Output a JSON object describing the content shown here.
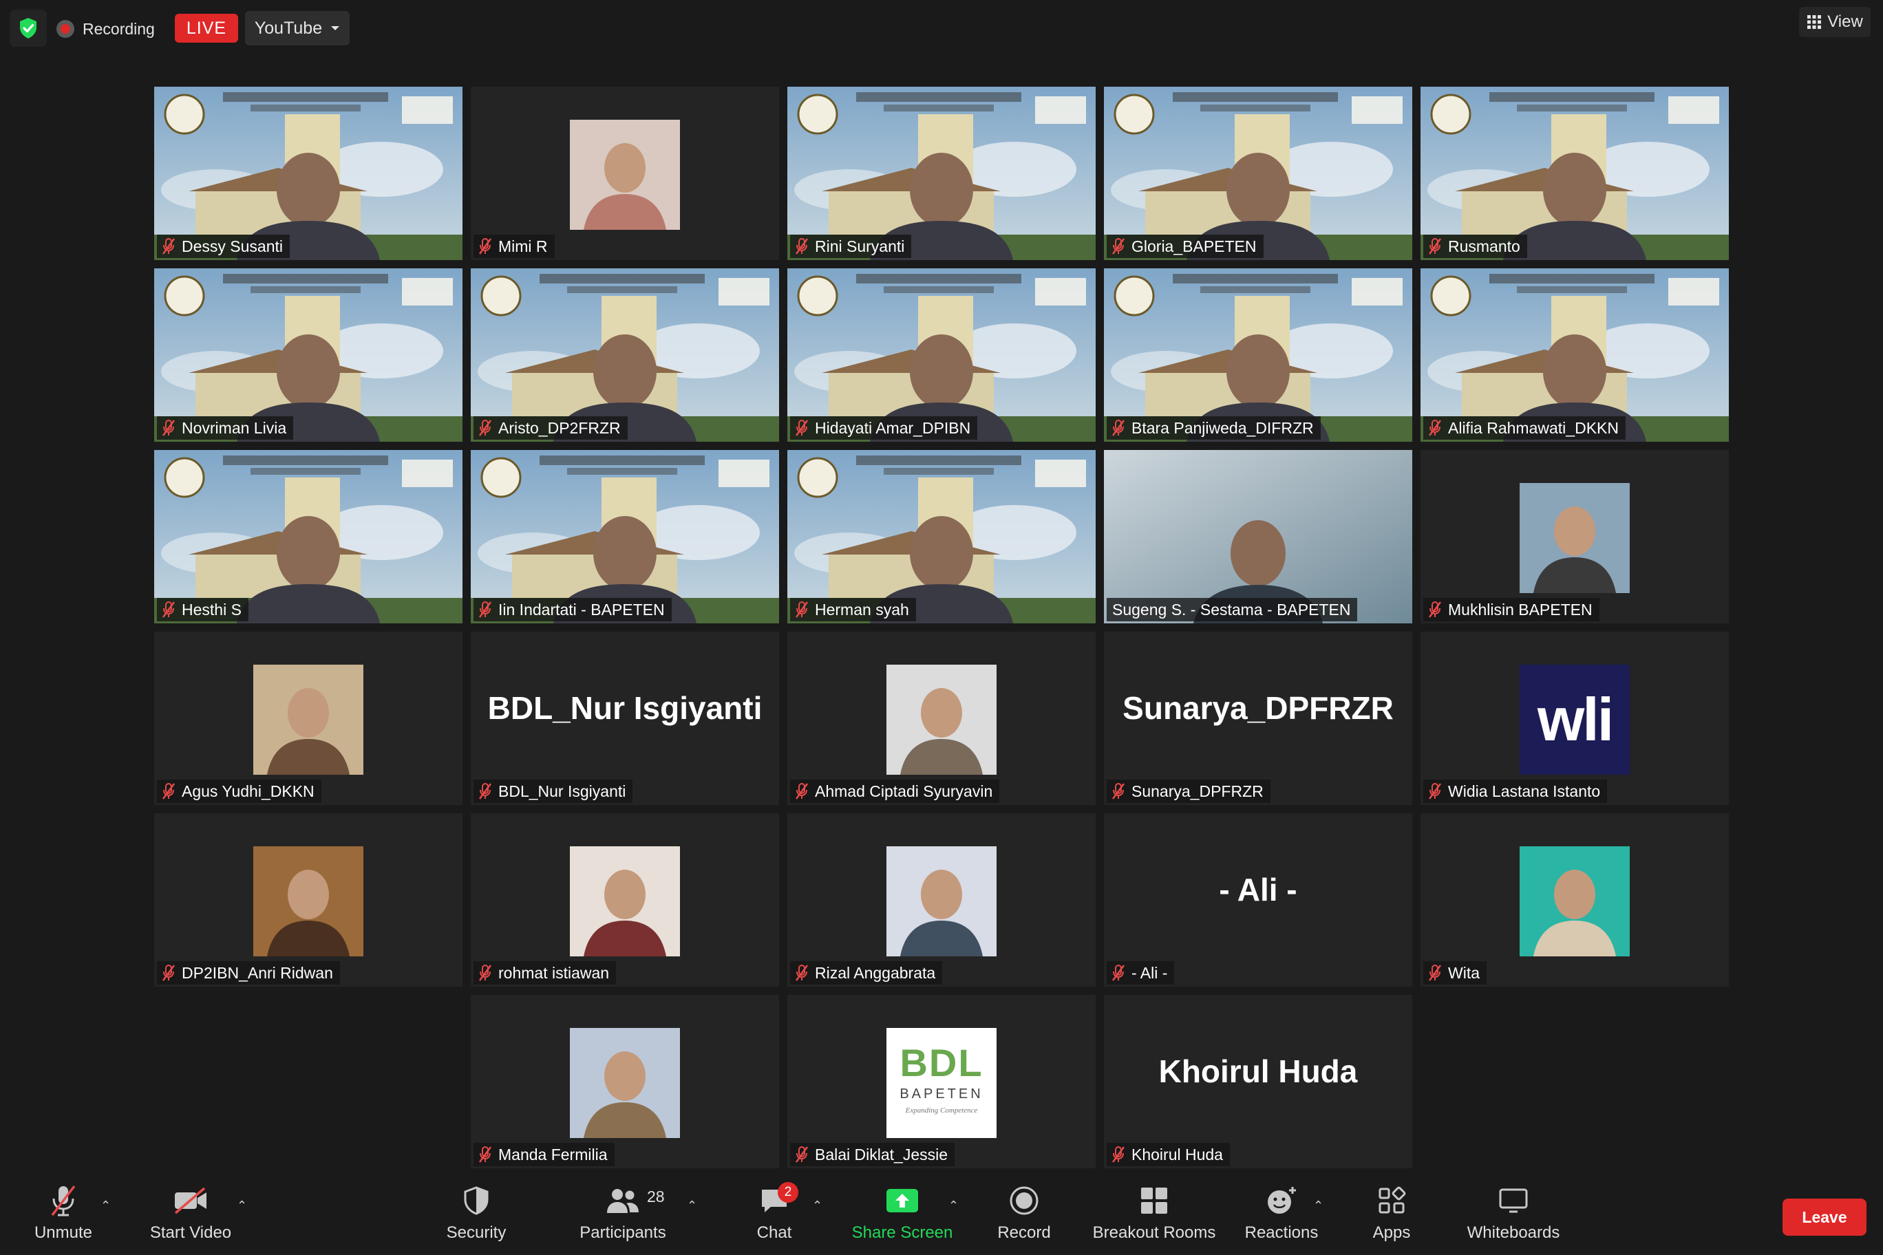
{
  "topbar": {
    "recording_label": "Recording",
    "live_label": "LIVE",
    "stream_label": "YouTube",
    "view_label": "View"
  },
  "tiles": [
    {
      "name": "Dessy Susanti",
      "kind": "bg"
    },
    {
      "name": "Mimi R",
      "kind": "pic"
    },
    {
      "name": "Rini Suryanti",
      "kind": "bg"
    },
    {
      "name": "Gloria_BAPETEN",
      "kind": "bg"
    },
    {
      "name": "Rusmanto",
      "kind": "bg"
    },
    {
      "name": "Novriman Livia",
      "kind": "bg"
    },
    {
      "name": "Aristo_DP2FRZR",
      "kind": "bg"
    },
    {
      "name": "Hidayati Amar_DPIBN",
      "kind": "bg"
    },
    {
      "name": "Btara Panjiweda_DIFRZR",
      "kind": "bg"
    },
    {
      "name": "Alifia Rahmawati_DKKN",
      "kind": "bg"
    },
    {
      "name": "Hesthi S",
      "kind": "bg"
    },
    {
      "name": "Iin Indartati - BAPETEN",
      "kind": "bg"
    },
    {
      "name": "Herman syah",
      "kind": "bg"
    },
    {
      "name": "Sugeng S. - Sestama - BAPETEN",
      "kind": "speaker"
    },
    {
      "name": "Mukhlisin BAPETEN",
      "kind": "pic"
    },
    {
      "name": "Agus Yudhi_DKKN",
      "kind": "pic"
    },
    {
      "name": "BDL_Nur Isgiyanti",
      "kind": "text",
      "big": "BDL_Nur Isgiyanti"
    },
    {
      "name": "Ahmad Ciptadi Syuryavin",
      "kind": "pic"
    },
    {
      "name": "Sunarya_DPFRZR",
      "kind": "text",
      "big": "Sunarya_DPFRZR"
    },
    {
      "name": "Widia Lastana Istanto",
      "kind": "logo",
      "logo_text": "wli"
    },
    {
      "name": "DP2IBN_Anri Ridwan",
      "kind": "pic"
    },
    {
      "name": "rohmat istiawan",
      "kind": "pic"
    },
    {
      "name": "Rizal Anggabrata",
      "kind": "pic"
    },
    {
      "name": "- Ali -",
      "kind": "text",
      "big": "- Ali -"
    },
    {
      "name": "Wita",
      "kind": "pic"
    },
    {
      "name": "Manda Fermilia",
      "kind": "pic"
    },
    {
      "name": "Balai Diklat_Jessie",
      "kind": "logo",
      "logo_text": "BDL",
      "logo_sub": "BAPETEN",
      "logo_tag": "Expanding Competence"
    },
    {
      "name": "Khoirul Huda",
      "kind": "text",
      "big": "Khoirul Huda"
    }
  ],
  "toolbar": {
    "unmute": "Unmute",
    "start_video": "Start Video",
    "security": "Security",
    "participants": "Participants",
    "participants_count": "28",
    "chat": "Chat",
    "chat_badge": "2",
    "share_screen": "Share Screen",
    "record": "Record",
    "breakout_rooms": "Breakout Rooms",
    "reactions": "Reactions",
    "apps": "Apps",
    "whiteboards": "Whiteboards",
    "leave": "Leave"
  },
  "colors": {
    "live_red": "#e02828",
    "share_green": "#23d959",
    "active_speaker": "#e2e670",
    "muted_icon": "#e84a4a"
  }
}
